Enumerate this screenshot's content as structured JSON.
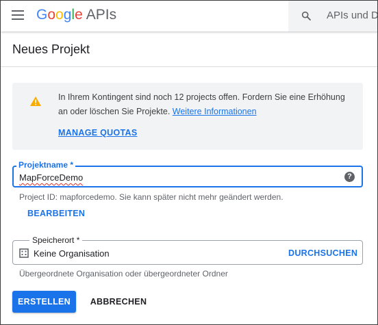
{
  "header": {
    "logo_letters": [
      "G",
      "o",
      "o",
      "g",
      "l",
      "e"
    ],
    "logo_suffix": "APIs",
    "search_placeholder": "APIs und D"
  },
  "page": {
    "title": "Neues Projekt"
  },
  "notice": {
    "text": "In Ihrem Kontingent sind noch 12 projects offen. Fordern Sie eine Erhöhung an oder löschen Sie Projekte. ",
    "link_label": "Weitere Informationen",
    "manage_quotas_label": "MANAGE QUOTAS",
    "icon": "warning-icon",
    "icon_color": "#f9ab00"
  },
  "project_name": {
    "label": "Projektname *",
    "value": "MapForceDemo",
    "help_icon": "?",
    "project_id_text": "Project ID: mapforcedemo. Sie kann später nicht mehr geändert werden.",
    "edit_label": "BEARBEITEN"
  },
  "location": {
    "label": "Speicherort *",
    "value": "Keine Organisation",
    "browse_label": "DURCHSUCHEN",
    "hint": "Übergeordnete Organisation oder übergeordneter Ordner",
    "icon": "building-icon"
  },
  "actions": {
    "create_label": "ERSTELLEN",
    "cancel_label": "ABBRECHEN"
  },
  "colors": {
    "accent": "#1a73e8",
    "notice_bg": "#f1f3f4",
    "text_muted": "#5f6368"
  }
}
